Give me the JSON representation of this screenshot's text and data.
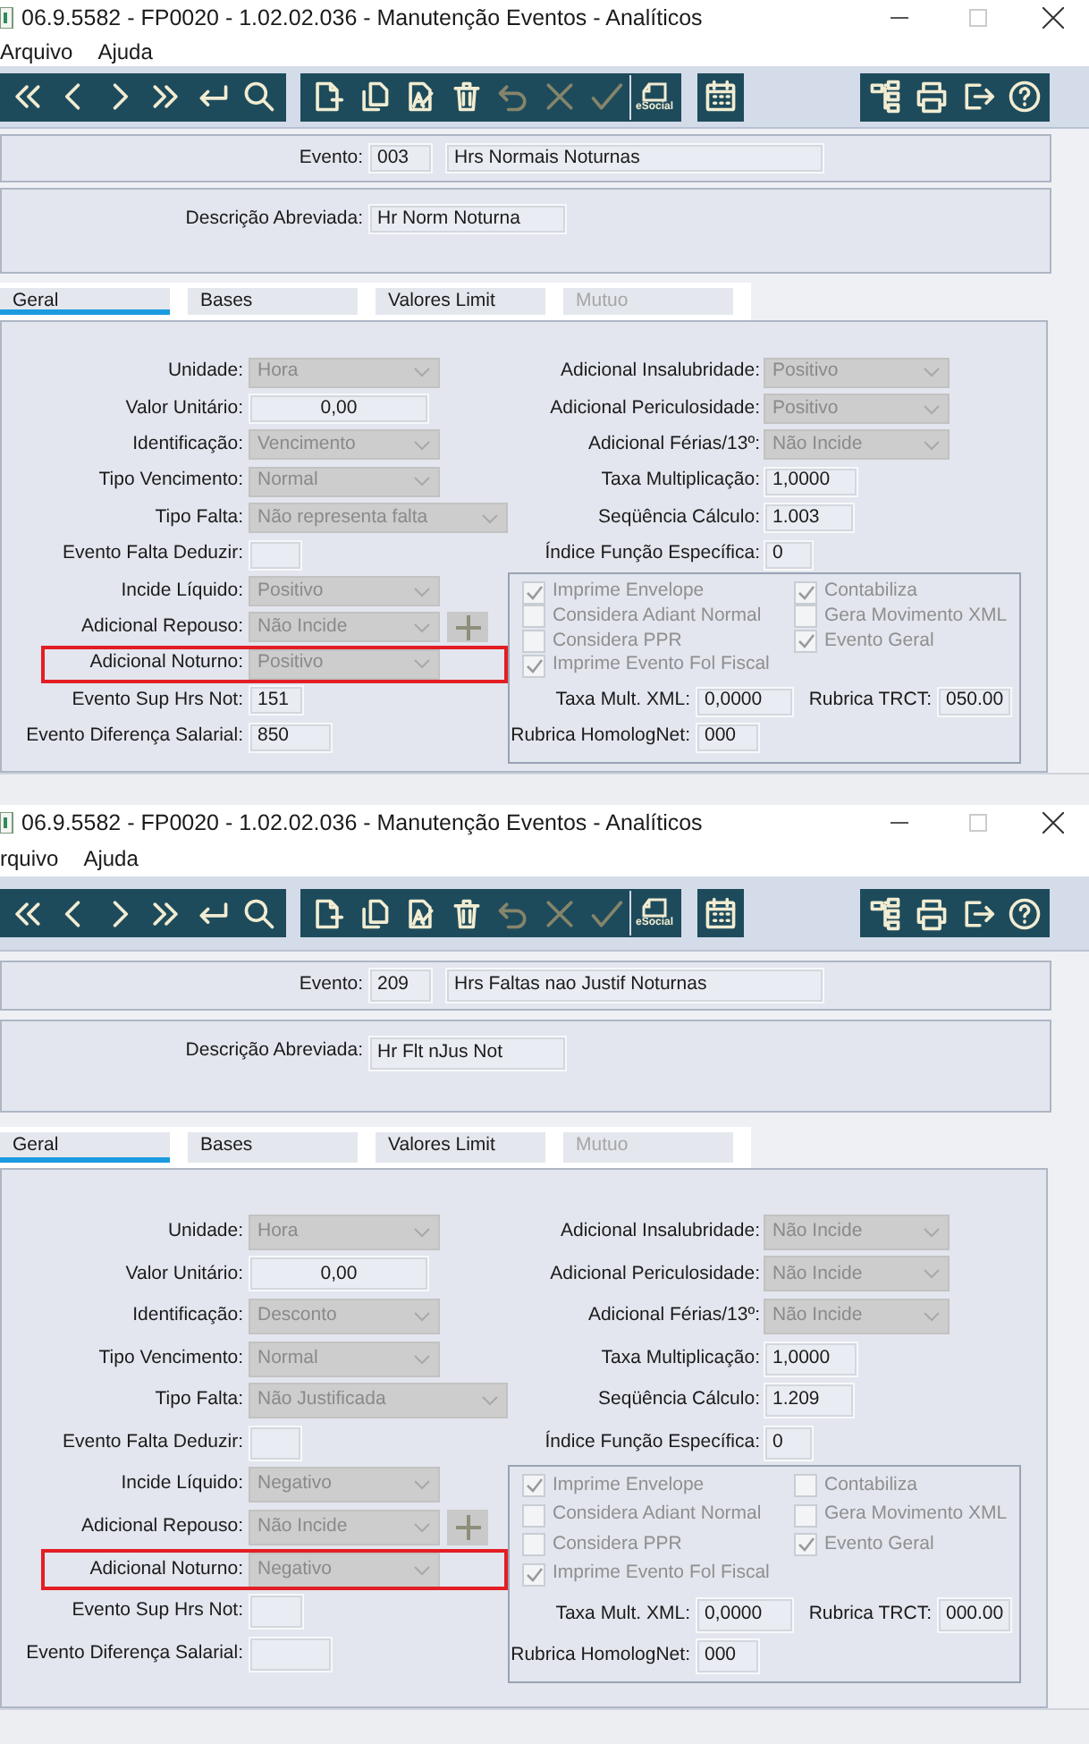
{
  "windows": [
    {
      "title": "06.9.5582 - FP0020 - 1.02.02.036 - Manutenção Eventos - Analíticos",
      "menu": [
        "Arquivo",
        "Ajuda"
      ],
      "esocial_label": "eSocial",
      "evento": {
        "label": "Evento:",
        "code": "003",
        "name": "Hrs Normais Noturnas"
      },
      "descricao": {
        "label": "Descrição Abreviada:",
        "value": "Hr Norm Noturna"
      },
      "tabs": [
        {
          "label": "Geral",
          "selected": true,
          "disabled": false
        },
        {
          "label": "Bases",
          "selected": false,
          "disabled": false
        },
        {
          "label": "Valores Limit",
          "selected": false,
          "disabled": false
        },
        {
          "label": "Mutuo",
          "selected": false,
          "disabled": true
        }
      ],
      "left_fields": [
        {
          "label": "Unidade:",
          "kind": "select",
          "value": "Hora",
          "highlighted": false
        },
        {
          "label": "Valor Unitário:",
          "kind": "number",
          "value": "0,00",
          "highlighted": false
        },
        {
          "label": "Identificação:",
          "kind": "select",
          "value": "Vencimento",
          "highlighted": false
        },
        {
          "label": "Tipo Vencimento:",
          "kind": "select",
          "value": "Normal",
          "highlighted": false
        },
        {
          "label": "Tipo Falta:",
          "kind": "select",
          "value": "Não representa falta",
          "highlighted": false
        },
        {
          "label": "Evento Falta Deduzir:",
          "kind": "input",
          "highlighted": false
        },
        {
          "label": "Incide Líquido:",
          "kind": "select",
          "value": "Positivo",
          "highlighted": false
        },
        {
          "label": "Adicional Repouso:",
          "kind": "select-add",
          "value": "Não Incide",
          "highlighted": false
        },
        {
          "label": "Adicional Noturno:",
          "kind": "select",
          "value": "Positivo",
          "highlighted": true
        },
        {
          "label": "Evento Sup Hrs Not:",
          "kind": "input",
          "value": "151",
          "highlighted": false
        },
        {
          "label": "Evento Diferença Salarial:",
          "kind": "input",
          "value": "850",
          "highlighted": false
        }
      ],
      "right_fields": [
        {
          "label": "Adicional Insalubridade:",
          "kind": "select",
          "value": "Positivo"
        },
        {
          "label": "Adicional Periculosidade:",
          "kind": "select",
          "value": "Positivo"
        },
        {
          "label": "Adicional Férias/13º:",
          "kind": "select",
          "value": "Não Incide"
        },
        {
          "label": "Taxa Multiplicação:",
          "kind": "input",
          "value": "1,0000"
        },
        {
          "label": "Seqüência Cálculo:",
          "kind": "input",
          "value": "1.003"
        },
        {
          "label": "Índice Função Específica:",
          "kind": "input",
          "value": "0"
        }
      ],
      "checkboxes": [
        {
          "label": "Imprime Envelope",
          "checked": true
        },
        {
          "label": "Considera Adiant Normal",
          "checked": false
        },
        {
          "label": "Considera PPR",
          "checked": false
        },
        {
          "label": "Imprime Evento Fol Fiscal",
          "checked": true
        },
        {
          "label": "Contabiliza",
          "checked": true
        },
        {
          "label": "Gera Movimento XML",
          "checked": false
        },
        {
          "label": "Evento Geral",
          "checked": true
        }
      ],
      "group_fields": [
        {
          "label": "Taxa Mult. XML:",
          "value": "0,0000"
        },
        {
          "label": "Rubrica TRCT:",
          "value": "050.00"
        },
        {
          "label": "Rubrica HomologNet:",
          "value": "000"
        }
      ]
    },
    {
      "title": "06.9.5582 - FP0020 - 1.02.02.036 - Manutenção Eventos - Analíticos",
      "menu": [
        "rquivo",
        "Ajuda"
      ],
      "esocial_label": "eSocial",
      "evento": {
        "label": "Evento:",
        "code": "209",
        "name": "Hrs Faltas nao Justif Noturnas"
      },
      "descricao": {
        "label": "Descrição Abreviada:",
        "value": "Hr Flt nJus Not"
      },
      "tabs": [
        {
          "label": "Geral",
          "selected": true,
          "disabled": false
        },
        {
          "label": "Bases",
          "selected": false,
          "disabled": false
        },
        {
          "label": "Valores Limit",
          "selected": false,
          "disabled": false
        },
        {
          "label": "Mutuo",
          "selected": false,
          "disabled": true
        }
      ],
      "left_fields": [
        {
          "label": "Unidade:",
          "kind": "select",
          "value": "Hora",
          "highlighted": false
        },
        {
          "label": "Valor Unitário:",
          "kind": "number",
          "value": "0,00",
          "highlighted": false
        },
        {
          "label": "Identificação:",
          "kind": "select",
          "value": "Desconto",
          "highlighted": false
        },
        {
          "label": "Tipo Vencimento:",
          "kind": "select",
          "value": "Normal",
          "highlighted": false
        },
        {
          "label": "Tipo Falta:",
          "kind": "select",
          "value": "Não Justificada",
          "highlighted": false
        },
        {
          "label": "Evento Falta Deduzir:",
          "kind": "input",
          "highlighted": false
        },
        {
          "label": "Incide Líquido:",
          "kind": "select",
          "value": "Negativo",
          "highlighted": false
        },
        {
          "label": "Adicional Repouso:",
          "kind": "select-add",
          "value": "Não Incide",
          "highlighted": false
        },
        {
          "label": "Adicional Noturno:",
          "kind": "select",
          "value": "Negativo",
          "highlighted": true
        },
        {
          "label": "Evento Sup Hrs Not:",
          "kind": "input",
          "highlighted": false
        },
        {
          "label": "Evento Diferença Salarial:",
          "kind": "input",
          "highlighted": false
        }
      ],
      "right_fields": [
        {
          "label": "Adicional Insalubridade:",
          "kind": "select",
          "value": "Não Incide"
        },
        {
          "label": "Adicional Periculosidade:",
          "kind": "select",
          "value": "Não Incide"
        },
        {
          "label": "Adicional Férias/13º:",
          "kind": "select",
          "value": "Não Incide"
        },
        {
          "label": "Taxa Multiplicação:",
          "kind": "input",
          "value": "1,0000"
        },
        {
          "label": "Seqüência Cálculo:",
          "kind": "input",
          "value": "1.209"
        },
        {
          "label": "Índice Função Específica:",
          "kind": "input",
          "value": "0"
        }
      ],
      "checkboxes": [
        {
          "label": "Imprime Envelope",
          "checked": true
        },
        {
          "label": "Considera Adiant Normal",
          "checked": false
        },
        {
          "label": "Considera PPR",
          "checked": false
        },
        {
          "label": "Imprime Evento Fol Fiscal",
          "checked": true
        },
        {
          "label": "Contabiliza",
          "checked": false
        },
        {
          "label": "Gera Movimento XML",
          "checked": false
        },
        {
          "label": "Evento Geral",
          "checked": true
        }
      ],
      "group_fields": [
        {
          "label": "Taxa Mult. XML:",
          "value": "0,0000"
        },
        {
          "label": "Rubrica TRCT:",
          "value": "000.00"
        },
        {
          "label": "Rubrica HomologNet:",
          "value": "000"
        }
      ]
    }
  ]
}
